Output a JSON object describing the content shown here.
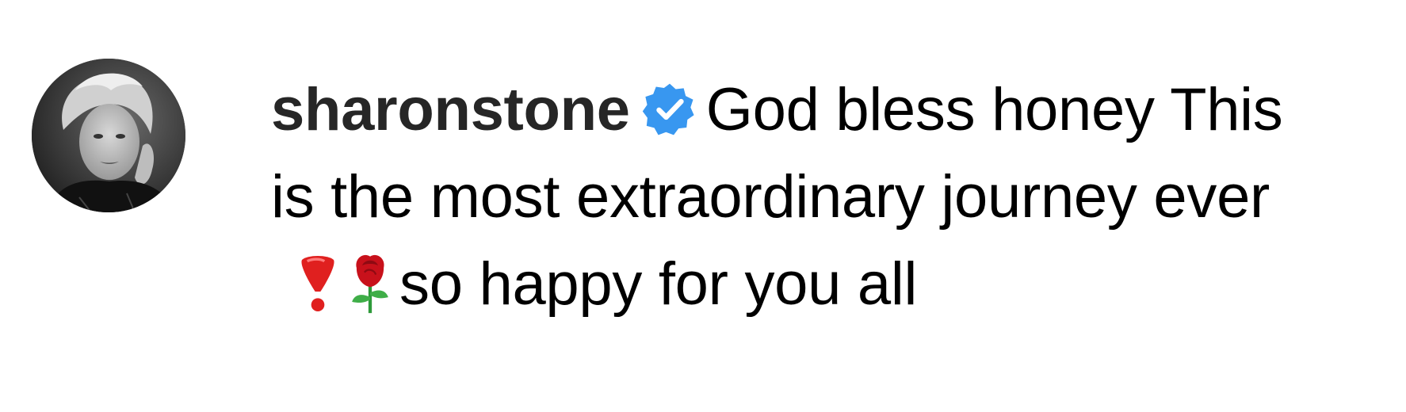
{
  "comment": {
    "username": "sharonstone",
    "verified_icon": "verified-badge-icon",
    "verified_color": "#3897f0",
    "text_before_emoji": "God bless honey This is the most extraordinary journey ever ",
    "emoji_1": "heavy-exclamation-icon",
    "emoji_2": "rose-icon",
    "text_after_emoji": "so happy for you all"
  },
  "avatar": {
    "icon": "avatar"
  }
}
